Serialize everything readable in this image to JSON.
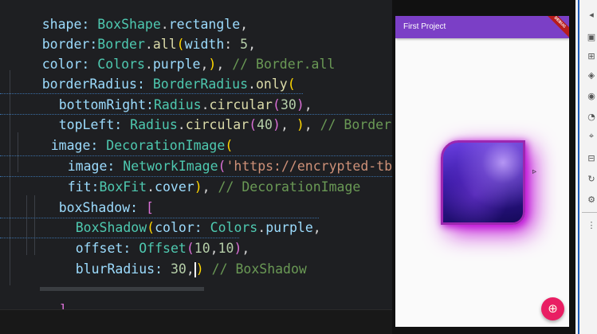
{
  "editor": {
    "lines": [
      [
        "shape: ",
        "BoxShape",
        ".",
        "rectangle",
        ","
      ],
      [
        "border:",
        "Border",
        ".",
        "all",
        "(",
        "width",
        ": ",
        "5",
        ","
      ],
      [
        "color: ",
        "Colors",
        ".",
        "purple",
        ",",
        ")",
        ", ",
        "// Border.all"
      ],
      [
        "borderRadius: ",
        "BorderRadius",
        ".",
        "only",
        "("
      ],
      [
        "bottomRight:",
        "Radius",
        ".",
        "circular",
        "(",
        "30",
        ")",
        ","
      ],
      [
        "topLeft: ",
        "Radius",
        ".",
        "circular",
        "(",
        "40",
        ")",
        ", ",
        ")",
        ", ",
        "// BorderR"
      ],
      [
        "image: ",
        "DecorationImage",
        "("
      ],
      [
        "image: ",
        "NetworkImage",
        "(",
        "'https://encrypted-tbn"
      ],
      [
        "fit:",
        "BoxFit",
        ".",
        "cover",
        ")",
        ", ",
        "// DecorationImage"
      ],
      [
        "boxShadow: ",
        "["
      ],
      [
        "BoxShadow",
        "(",
        "color: ",
        "Colors",
        ".",
        "purple",
        ","
      ],
      [
        "offset: ",
        "Offset",
        "(",
        "10",
        ",",
        "10",
        ")",
        ","
      ],
      [
        "blurRadius: ",
        "30",
        ",",
        ")",
        " ",
        "// BoxShadow"
      ],
      [
        ""
      ],
      [
        "]"
      ]
    ]
  },
  "app": {
    "title": "First Project",
    "debug_banner": "DEBUG",
    "fab_icon": "add-circle-icon",
    "fab_glyph": "⊕",
    "accent_color": "#7b3fc6",
    "shadow_color": "#9c27b0",
    "fab_color": "#e91e63"
  },
  "toolbar": {
    "icons": [
      "back-icon",
      "select-widget-icon",
      "layout-icon",
      "paint-icon",
      "camera-icon",
      "slow-animations-icon",
      "repaint-icon",
      "baseline-icon",
      "refresh-icon",
      "settings-icon",
      "more-icon"
    ],
    "glyphs": [
      "◂",
      "▣",
      "⊞",
      "◈",
      "◉",
      "◔",
      "⌖",
      "⊟",
      "↻",
      "⚙",
      "⋮"
    ]
  }
}
